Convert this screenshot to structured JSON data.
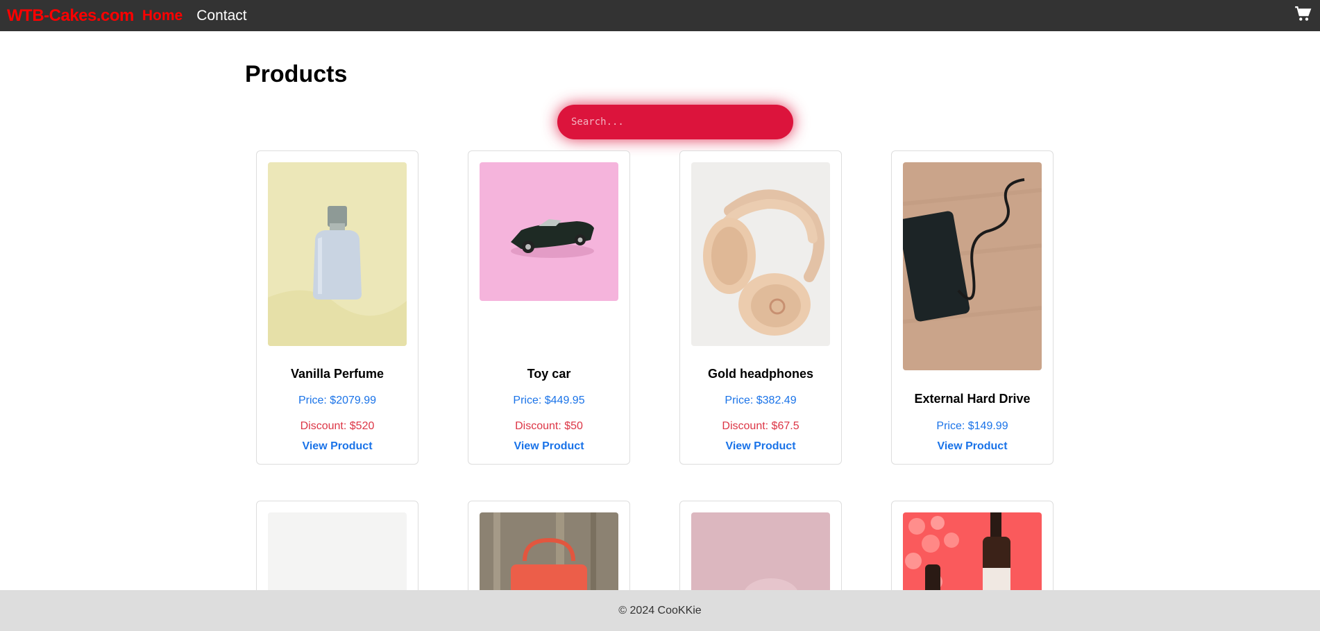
{
  "navbar": {
    "brand": "WTB-Cakes.com",
    "links": [
      "Home",
      "Contact"
    ],
    "cart_icon": "cart-icon"
  },
  "main": {
    "title": "Products",
    "search": {
      "placeholder": "Search...",
      "value": ""
    },
    "products": [
      {
        "name": "Vanilla Perfume",
        "price": "Price: $2079.99",
        "discount": "Discount: $520",
        "link": "View Product"
      },
      {
        "name": "Toy car",
        "price": "Price: $449.95",
        "discount": "Discount: $50",
        "link": "View Product"
      },
      {
        "name": "Gold headphones",
        "price": "Price: $382.49",
        "discount": "Discount: $67.5",
        "link": "View Product"
      },
      {
        "name": "External Hard Drive",
        "price": "Price: $149.99",
        "link": "View Product"
      }
    ]
  },
  "footer": {
    "text": "© 2024 CooKKie"
  },
  "colors": {
    "accent": "#dc143c",
    "brand": "#ff0000",
    "link": "#1a73e8",
    "discount": "#dc3545",
    "navbar": "#333333"
  }
}
